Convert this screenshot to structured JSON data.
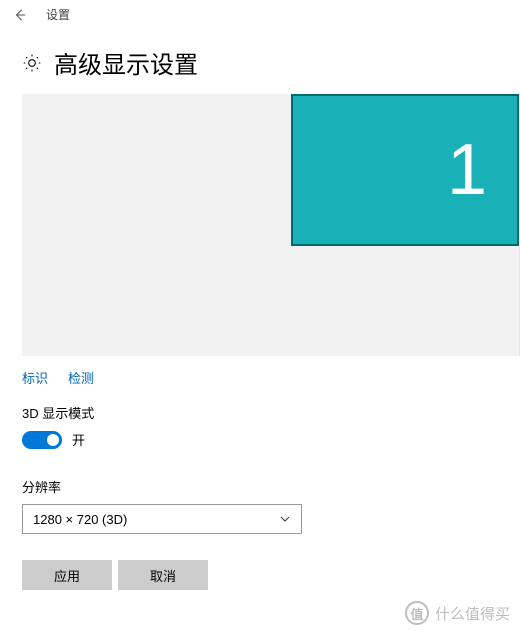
{
  "titlebar": {
    "title": "设置"
  },
  "header": {
    "page_title": "高级显示设置"
  },
  "preview": {
    "monitor_number": "1"
  },
  "links": {
    "identify": "标识",
    "detect": "检测"
  },
  "mode3d": {
    "label": "3D 显示模式",
    "state": "开"
  },
  "resolution": {
    "label": "分辨率",
    "value": "1280 × 720 (3D)"
  },
  "buttons": {
    "apply": "应用",
    "cancel": "取消"
  },
  "watermark": {
    "icon_text": "值",
    "text": "什么值得买"
  }
}
